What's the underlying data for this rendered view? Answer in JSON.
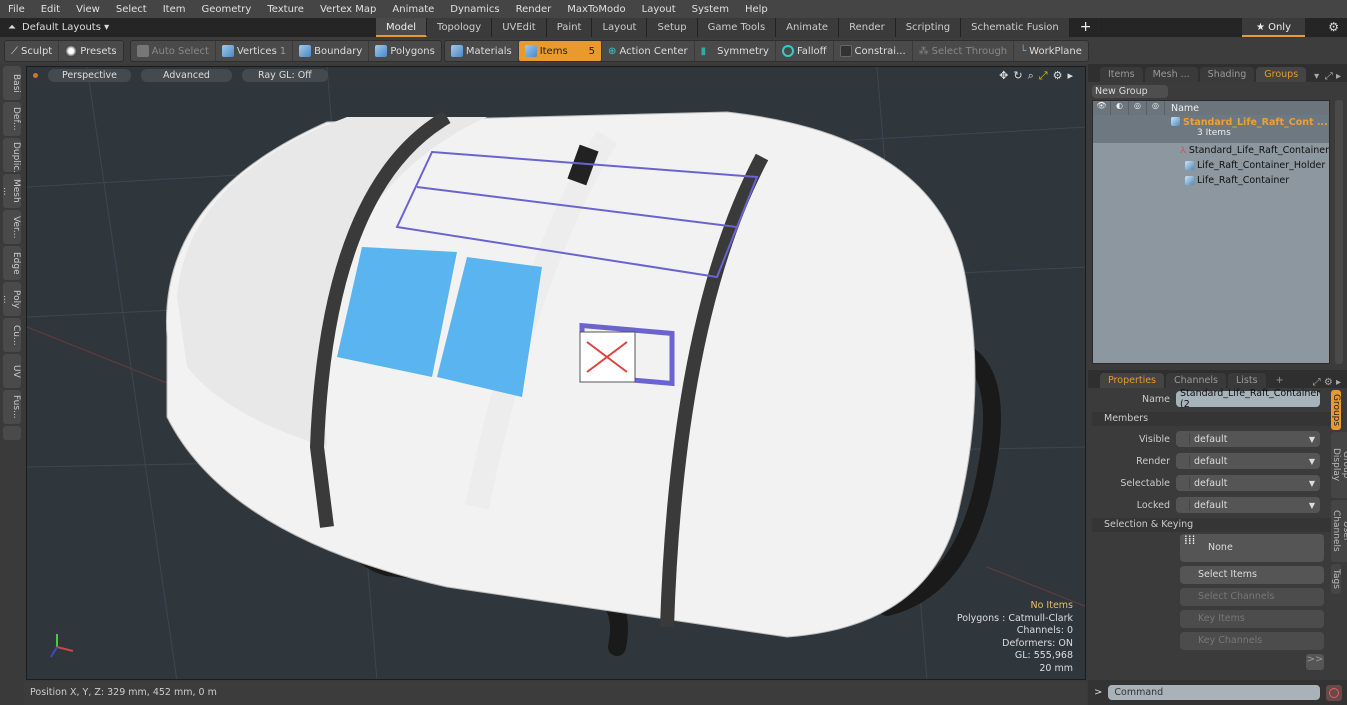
{
  "menu": [
    "File",
    "Edit",
    "View",
    "Select",
    "Item",
    "Geometry",
    "Texture",
    "Vertex Map",
    "Animate",
    "Dynamics",
    "Render",
    "MaxToModo",
    "Layout",
    "System",
    "Help"
  ],
  "layout_bar": {
    "title": "Default Layouts ▾",
    "tabs": [
      "Model",
      "Topology",
      "UVEdit",
      "Paint",
      "Layout",
      "Setup",
      "Game Tools",
      "Animate",
      "Render",
      "Scripting",
      "Schematic Fusion"
    ],
    "active_tab": "Model",
    "plus": "+",
    "only_label": "★  Only"
  },
  "toolbar": {
    "sculpt": "Sculpt",
    "presets": "Presets",
    "auto_select": "Auto Select",
    "vertices": "Vertices",
    "vertices_count": "1",
    "boundary": "Boundary",
    "polygons": "Polygons",
    "materials": "Materials",
    "items": "Items",
    "items_count": "5",
    "action_center": "Action Center",
    "symmetry": "Symmetry",
    "falloff": "Falloff",
    "constraints": "Constrai...",
    "select_through": "Select Through",
    "workplane": "WorkPlane"
  },
  "left_tabs": [
    "Basi",
    "Def...",
    "Duplic...",
    "Mesh ...",
    "Ver...",
    "Edge",
    "Poly ...",
    "Cu...",
    "UV",
    "Fus..."
  ],
  "viewport": {
    "view_mode": "Perspective",
    "shading": "Advanced",
    "raygl": "Ray GL: Off",
    "stats": {
      "items": "No Items",
      "polygons": "Polygons : Catmull-Clark",
      "channels": "Channels: 0",
      "deformers": "Deformers: ON",
      "gl": "GL: 555,968",
      "unit": "20 mm"
    }
  },
  "status": "Position X, Y, Z:   329 mm, 452 mm, 0 m",
  "groups_panel": {
    "tabs": [
      "Items",
      "Mesh ...",
      "Shading",
      "Groups"
    ],
    "active_tab": "Groups",
    "new_group": "New Group",
    "name_header": "Name",
    "group_name": "Standard_Life_Raft_Cont ...",
    "group_count": "3 Items",
    "children": [
      "Standard_Life_Raft_Container",
      "Life_Raft_Container_Holder",
      "Life_Raft_Container"
    ]
  },
  "properties_panel": {
    "tabs": [
      "Properties",
      "Channels",
      "Lists",
      "+"
    ],
    "active_tab": "Properties",
    "name_label": "Name",
    "name_value": "Standard_Life_Raft_Container (2",
    "members_section": "Members",
    "fields": [
      {
        "label": "Visible",
        "value": "default"
      },
      {
        "label": "Render",
        "value": "default"
      },
      {
        "label": "Selectable",
        "value": "default"
      },
      {
        "label": "Locked",
        "value": "default"
      }
    ],
    "keying_section": "Selection & Keying",
    "none_label": "None",
    "select_items": "Select Items",
    "select_channels": "Select Channels",
    "key_items": "Key Items",
    "key_channels": "Key Channels",
    "more": ">>",
    "side_tabs": [
      "Groups",
      "Group Display",
      "User Channels",
      "Tags"
    ]
  },
  "command": {
    "prompt": ">",
    "placeholder": "Command"
  }
}
